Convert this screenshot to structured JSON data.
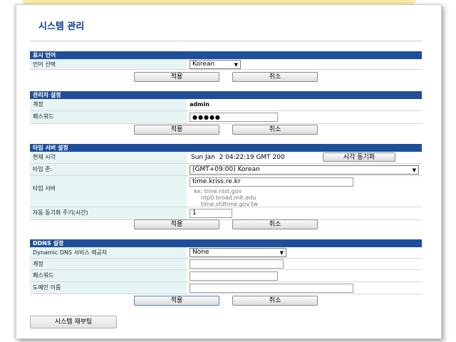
{
  "page": {
    "title": "시스템 관리"
  },
  "language": {
    "header": "표시 언어",
    "label": "언어 선택",
    "value": "Korean",
    "apply": "적용",
    "cancel": "취소"
  },
  "admin": {
    "header": "관리자 설정",
    "account_label": "계정",
    "account_value": "admin",
    "password_label": "패스워드",
    "password_value": "●●●●●",
    "apply": "적용",
    "cancel": "취소"
  },
  "time": {
    "header": "타임 서버 설정",
    "current_label": "현재 시각",
    "current_value": "Sun Jan  2 04:22:19 GMT 200",
    "sync_button": "시각 동기화",
    "zone_label": "타임 존:",
    "zone_value": "(GMT+09:00) Korean",
    "server_label": "타임 서버",
    "server_value": "time.kriss.re.kr",
    "server_hints": [
      "ex: time.nist.gov",
      "ntp0.broad.mit.edu",
      "time.stdtime.gov.tw"
    ],
    "interval_label": "자동 동기화 주기(시간)",
    "interval_value": "1",
    "apply": "적용",
    "cancel": "취소"
  },
  "ddns": {
    "header": "DDNS 설정",
    "provider_label": "Dynamic DNS 서비스 제공자",
    "provider_value": "None",
    "account_label": "계정",
    "account_value": "",
    "password_label": "패스워드",
    "password_value": "",
    "domain_label": "도메인 이름",
    "domain_value": "",
    "apply": "적용",
    "cancel": "취소"
  },
  "reboot": {
    "label": "시스템 재부팅"
  }
}
